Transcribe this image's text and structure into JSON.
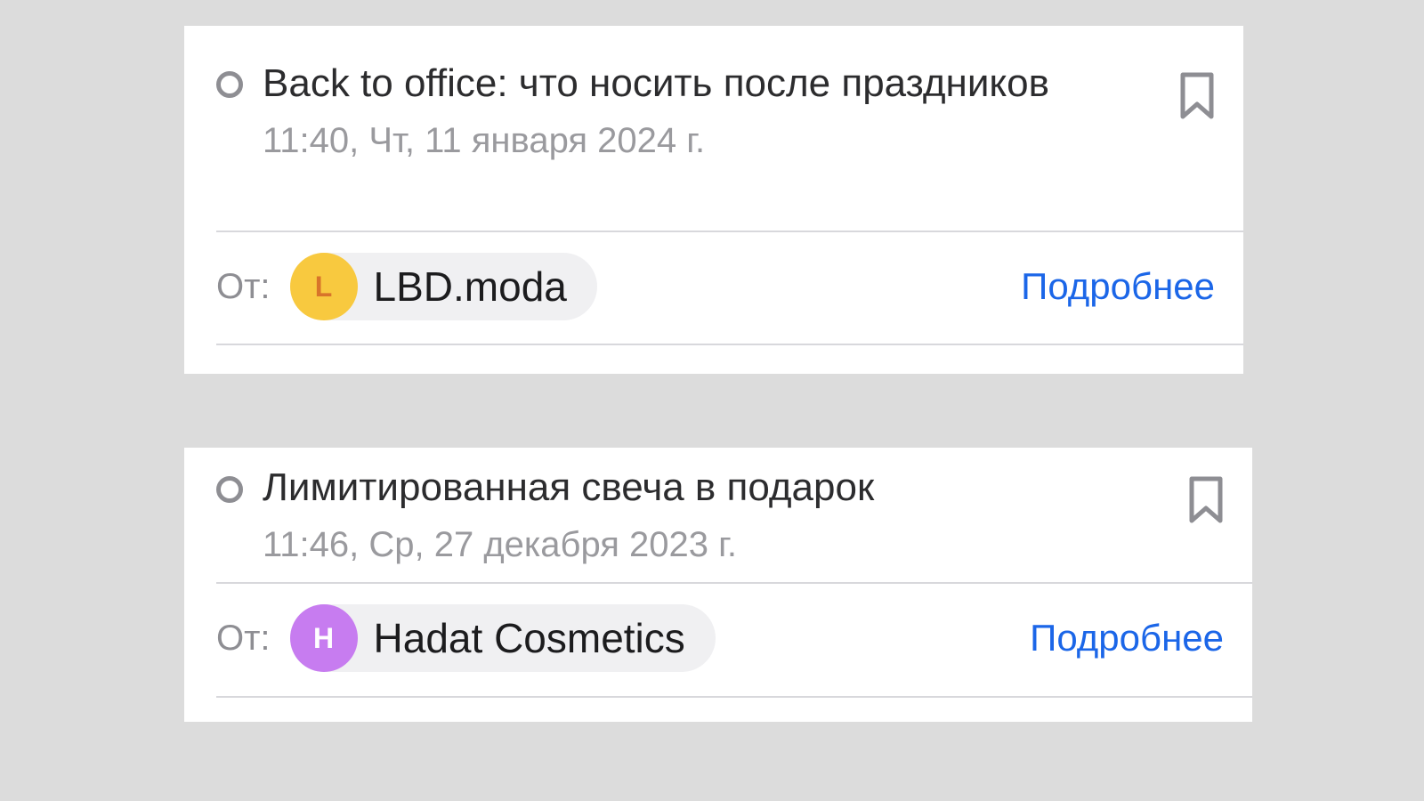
{
  "colors": {
    "background": "#dcdcdc",
    "card": "#ffffff",
    "link": "#1b66e8",
    "avatar_1": "#f8c93f",
    "avatar_2": "#c77cf0"
  },
  "messages": [
    {
      "subject": "Back to office: что носить после праздников",
      "timestamp": "11:40, Чт, 11 января 2024 г.",
      "from_label": "От:",
      "sender": {
        "initial": "L",
        "name": "LBD.moda"
      },
      "details_label": "Подробнее",
      "icons": {
        "status": "unread-circle",
        "bookmark": "bookmark-icon"
      }
    },
    {
      "subject": "Лимитированная свеча в подарок",
      "timestamp": "11:46, Ср, 27 декабря 2023 г.",
      "from_label": "От:",
      "sender": {
        "initial": "H",
        "name": "Hadat Cosmetics"
      },
      "details_label": "Подробнее",
      "icons": {
        "status": "unread-circle",
        "bookmark": "bookmark-icon"
      }
    }
  ]
}
